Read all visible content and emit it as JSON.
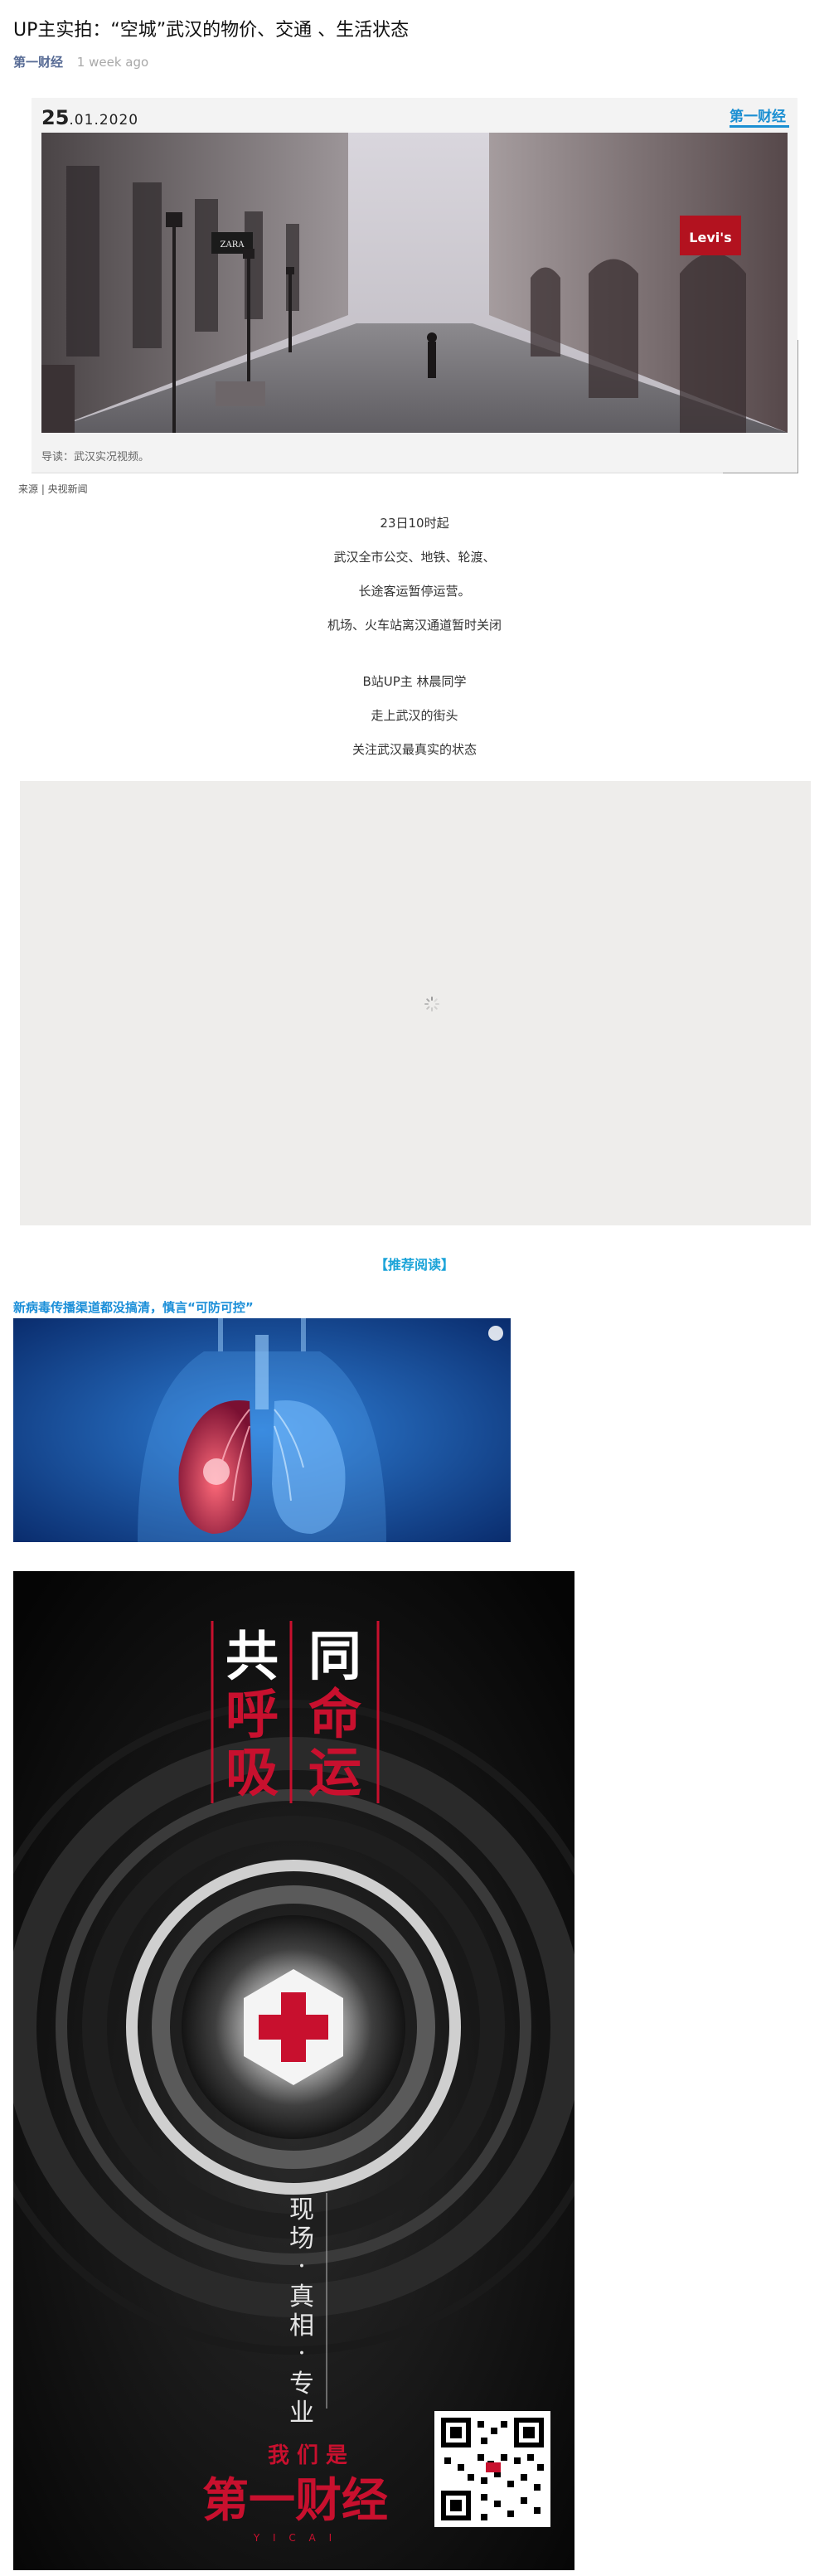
{
  "article": {
    "title": "UP主实拍：“空城”武汉的物价、交通 、生活状态",
    "account": "第一财经",
    "time": "1 week ago"
  },
  "video_card": {
    "date_day": "25",
    "date_rest": ".01.2020",
    "logo_text": "第一财经",
    "caption": "导读：武汉实况视频。",
    "storefront_sign": "ZARA",
    "storefront_sign2": "Levi's"
  },
  "source": "来源 | 央视新闻",
  "body_lines_1": [
    "23日10时起",
    "武汉全市公交、地铁、轮渡、",
    "长途客运暂停运营。",
    "机场、火车站离汉通道暂时关闭"
  ],
  "body_lines_2": [
    "B站UP主 林晨同学",
    "走上武汉的街头",
    "关注武汉最真实的状态"
  ],
  "recommend": {
    "heading": "【推荐阅读】",
    "link": "新病毒传播渠道都没搞清，慎言“可防可控”"
  },
  "poster": {
    "col1_top": "共",
    "col1_rest": [
      "呼",
      "吸"
    ],
    "col2_top": "同",
    "col2_rest": [
      "命",
      "运"
    ],
    "vertical_slogan": [
      "现",
      "场",
      "·",
      "真",
      "相",
      "·",
      "专",
      "业"
    ],
    "we_are": "我 们 是",
    "brand": "第一财经",
    "brand_sub": "Y I C A I",
    "colors": {
      "red": "#c8102e",
      "dark": "#050505"
    }
  }
}
